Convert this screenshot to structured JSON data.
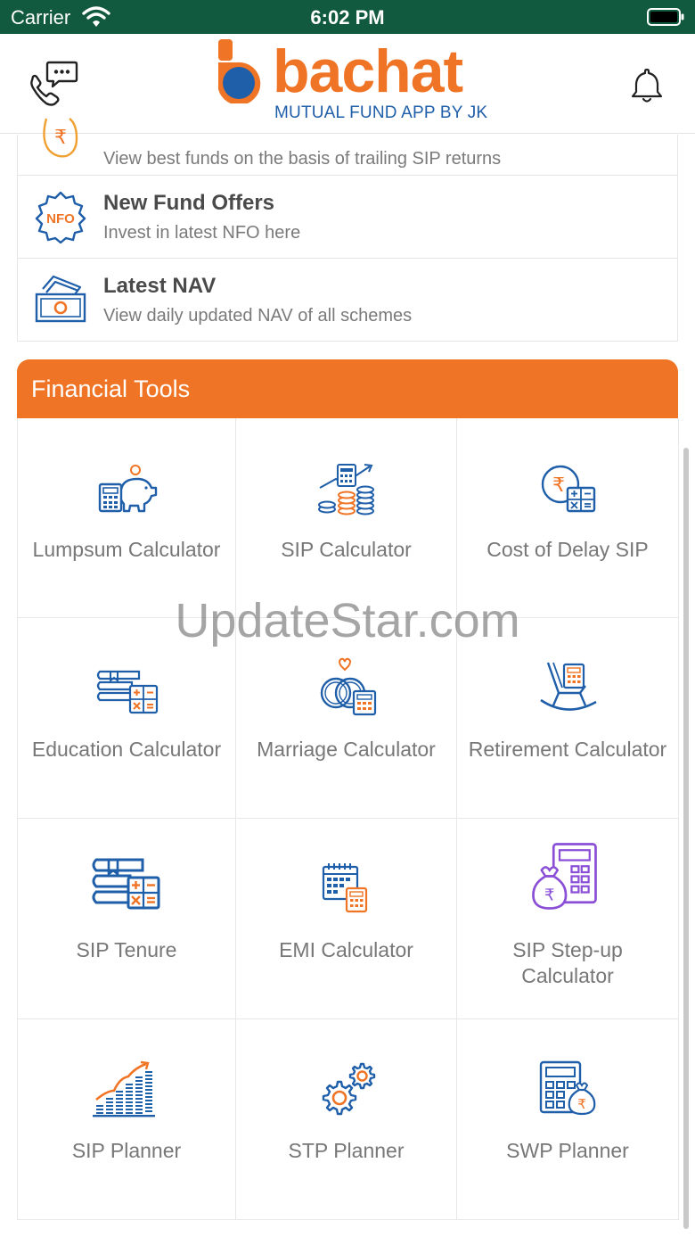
{
  "status_bar": {
    "carrier": "Carrier",
    "time": "6:02 PM"
  },
  "header": {
    "brand": "bachat",
    "tagline": "MUTUAL FUND APP BY JK",
    "left_icon": "phone-chat-icon",
    "right_icon": "bell-icon"
  },
  "features": [
    {
      "title": "",
      "subtitle": "View best funds on the basis of trailing SIP returns",
      "icon": "rupee-coin-icon"
    },
    {
      "title": "New Fund Offers",
      "subtitle": "Invest in latest NFO here",
      "icon": "nfo-badge-icon"
    },
    {
      "title": "Latest NAV",
      "subtitle": "View daily updated NAV of all schemes",
      "icon": "cash-bills-icon"
    }
  ],
  "financial_tools": {
    "title": "Financial Tools",
    "items": [
      {
        "label": "Lumpsum Calculator",
        "icon": "piggy-bank-calculator-icon"
      },
      {
        "label": "SIP Calculator",
        "icon": "coins-growth-icon"
      },
      {
        "label": "Cost of Delay SIP",
        "icon": "rupee-calculator-icon"
      },
      {
        "label": "Education Calculator",
        "icon": "books-calculator-icon"
      },
      {
        "label": "Marriage Calculator",
        "icon": "rings-calculator-icon"
      },
      {
        "label": "Retirement Calculator",
        "icon": "rocking-chair-calculator-icon"
      },
      {
        "label": "SIP Tenure",
        "icon": "books-calculator-large-icon"
      },
      {
        "label": "EMI Calculator",
        "icon": "calendar-calculator-icon"
      },
      {
        "label": "SIP Step-up Calculator",
        "icon": "money-bag-calculator-icon"
      },
      {
        "label": "SIP Planner",
        "icon": "growth-bars-icon"
      },
      {
        "label": "STP Planner",
        "icon": "gears-icon"
      },
      {
        "label": "SWP Planner",
        "icon": "calculator-money-bag-icon"
      }
    ]
  },
  "watermark": "UpdateStar.com",
  "colors": {
    "status_bar": "#11593f",
    "accent_orange": "#f07425",
    "brand_blue": "#1f5ea8",
    "icon_blue": "#1f5ea8",
    "icon_purple": "#8a4fd6"
  }
}
